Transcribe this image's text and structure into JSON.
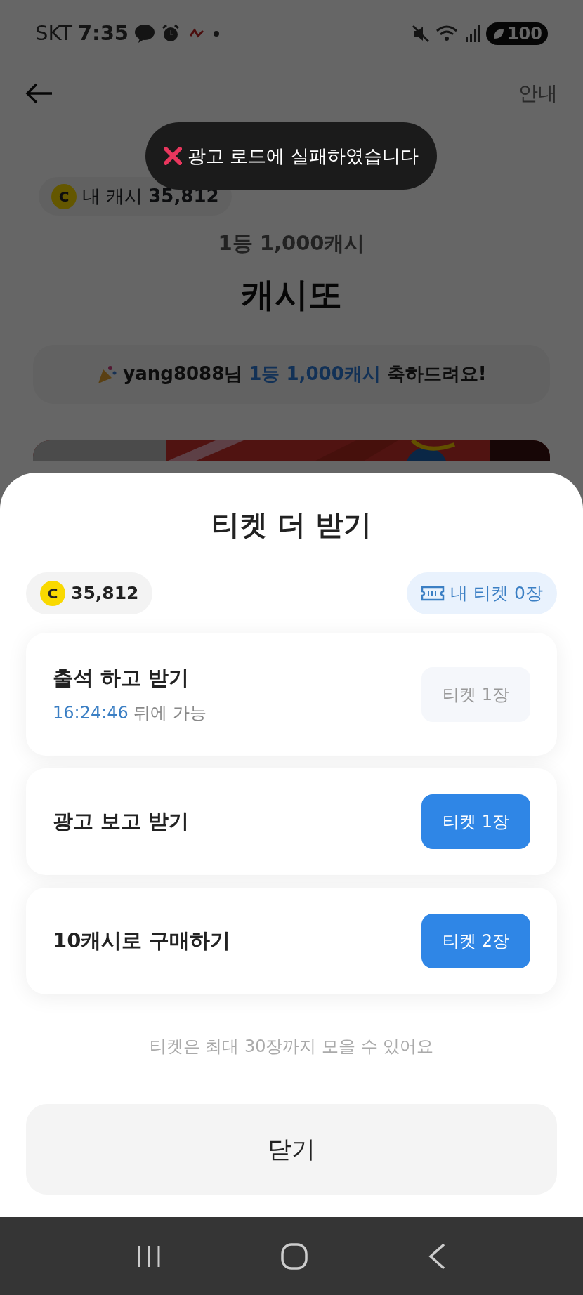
{
  "status_bar": {
    "carrier": "SKT",
    "time": "7:35",
    "battery": "100"
  },
  "header": {
    "info_link": "안내"
  },
  "toast": {
    "message": "광고 로드에 실패하였습니다"
  },
  "page": {
    "coin_symbol": "C",
    "cash_label": "내 캐시",
    "cash": "35,812",
    "prize": "1등 1,000캐시",
    "title": "캐시또",
    "winner_banner": {
      "user": "yang8088님",
      "prize": "1등 1,000캐시",
      "suffix": "축하드려요!"
    }
  },
  "sheet": {
    "title": "티켓 더 받기",
    "coin_symbol": "C",
    "cash": "35,812",
    "my_tickets": "내 티켓 0장",
    "options": [
      {
        "title": "출석 하고 받기",
        "timer": "16:24:46",
        "timer_suffix": "뒤에 가능",
        "reward": "티켓 1장",
        "disabled": true
      },
      {
        "title": "광고 보고 받기",
        "reward": "티켓 1장",
        "disabled": false
      },
      {
        "title": "10캐시로 구매하기",
        "reward": "티켓 2장",
        "disabled": false
      }
    ],
    "note": "티켓은 최대 30장까지 모을 수 있어요",
    "close": "닫기"
  }
}
